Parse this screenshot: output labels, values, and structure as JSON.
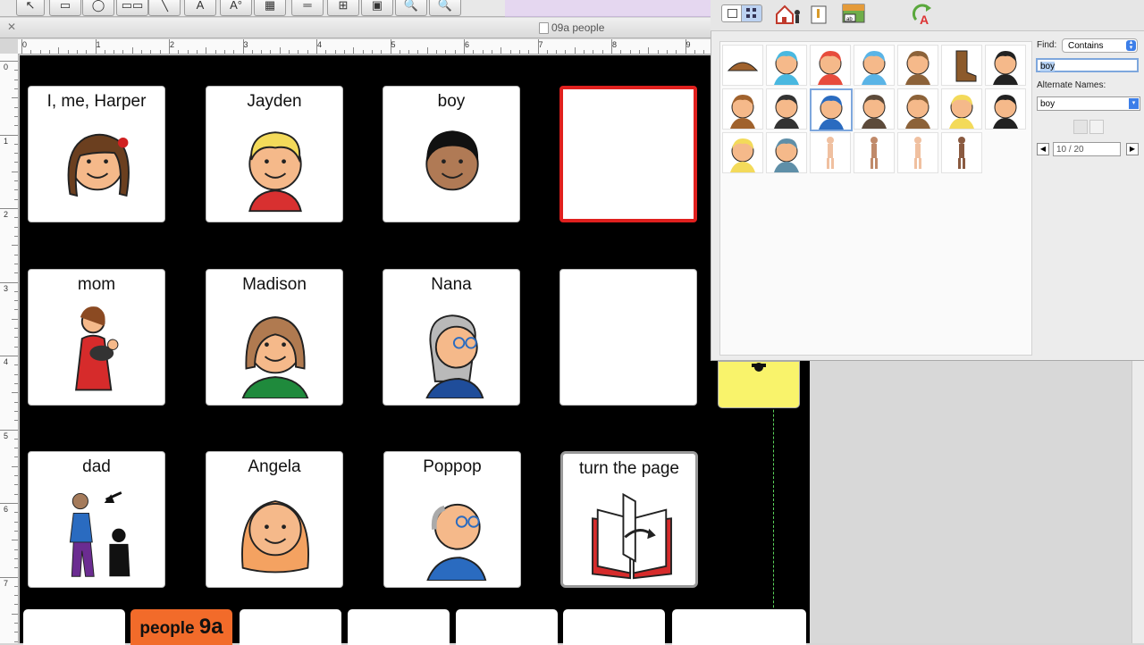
{
  "window": {
    "title": "09a people"
  },
  "toolbar": {
    "tools": [
      {
        "name": "pointer",
        "glyph": "↖"
      },
      {
        "name": "rectangle",
        "glyph": "▭"
      },
      {
        "name": "shape",
        "glyph": "◯"
      },
      {
        "name": "button-group",
        "glyph": "▭▭"
      },
      {
        "name": "line",
        "glyph": "╲"
      },
      {
        "name": "text",
        "glyph": "A"
      },
      {
        "name": "text-style",
        "glyph": "A°"
      },
      {
        "name": "color",
        "glyph": "▦"
      },
      {
        "name": "line-style",
        "glyph": "═"
      },
      {
        "name": "align",
        "glyph": "⊞"
      },
      {
        "name": "frame",
        "glyph": "▣"
      },
      {
        "name": "zoom-in",
        "glyph": "🔍"
      },
      {
        "name": "zoom-out",
        "glyph": "🔍"
      }
    ]
  },
  "ruler": {
    "h_labels": [
      "0",
      "1",
      "2",
      "3",
      "4",
      "5",
      "6",
      "7",
      "8",
      "9"
    ],
    "v_labels": [
      "0",
      "1",
      "2",
      "3",
      "4",
      "5",
      "6",
      "7"
    ]
  },
  "board": {
    "cells": [
      {
        "label": "I, me, Harper",
        "icon": "girl-face-icon"
      },
      {
        "label": "Jayden",
        "icon": "boy-blonde-icon"
      },
      {
        "label": "boy",
        "icon": "boy-face-icon"
      },
      {
        "label": "",
        "icon": ""
      },
      {
        "label": "mom",
        "icon": "mother-baby-icon"
      },
      {
        "label": "Madison",
        "icon": "woman-icon"
      },
      {
        "label": "Nana",
        "icon": "grandmother-icon"
      },
      {
        "label": "",
        "icon": ""
      },
      {
        "label": "dad",
        "icon": "father-child-icon"
      },
      {
        "label": "Angela",
        "icon": "girl-orange-hair-icon"
      },
      {
        "label": "Poppop",
        "icon": "grandfather-icon"
      },
      {
        "label": "turn the page",
        "icon": "book-icon"
      }
    ],
    "tabs": [
      {
        "label": ""
      },
      {
        "label": "people",
        "num": "9a"
      },
      {
        "label": ""
      },
      {
        "label": ""
      },
      {
        "label": ""
      },
      {
        "label": ""
      },
      {
        "label": ""
      }
    ]
  },
  "finder": {
    "find_label": "Find:",
    "match_mode": "Contains",
    "search_value": "boy",
    "alt_names_label": "Alternate Names:",
    "alt_name_value": "boy",
    "page_indicator": "10 / 20",
    "symbols": [
      "cowboy-hat-icon",
      "blue-shape-icon",
      "person-red-icon",
      "blue-blob-icon",
      "cowboy-icon",
      "boot-icon",
      "boy-black-hair-icon",
      "boy-brown-icon",
      "boy-dark-icon",
      "boy-blue-shirt-icon",
      "boy-jacket-icon",
      "cowboy-2-icon",
      "boy-blonde-icon",
      "boy-black-icon",
      "girl-blonde-icon",
      "boy-wheelchair-icon",
      "body-1-icon",
      "body-2-icon",
      "body-3-icon",
      "body-4-icon"
    ]
  }
}
